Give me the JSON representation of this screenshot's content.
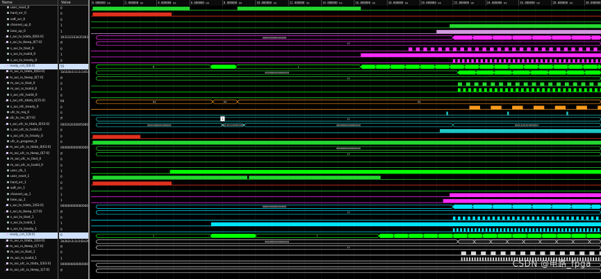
{
  "headers": {
    "name": "Name",
    "value": "Value"
  },
  "rows": [
    {
      "name": "user_reset_0",
      "value": "0",
      "type": "bit"
    },
    {
      "name": "hard_err_0",
      "value": "0",
      "type": "bit"
    },
    {
      "name": "soft_err_0",
      "value": "0",
      "type": "bit"
    },
    {
      "name": "channel_up_0",
      "value": "1",
      "type": "bit"
    },
    {
      "name": "lane_up_0",
      "value": "1",
      "type": "bit"
    },
    {
      "name": "s_axi_tx_tdata_0[63:0]",
      "value": "303132333435363?",
      "type": "bus"
    },
    {
      "name": "s_axi_tx_tkeep_0[7:0]",
      "value": "ff",
      "type": "bus"
    },
    {
      "name": "s_axi_tx_tlast_0",
      "value": "0",
      "type": "bit"
    },
    {
      "name": "s_axi_tx_tvalid_0",
      "value": "1",
      "type": "bit"
    },
    {
      "name": "s_axi_tx_tready_0",
      "value": "0",
      "type": "bit"
    },
    {
      "name": "ready_cnt_0[8:0]",
      "value": "55",
      "type": "bus",
      "selected": true
    },
    {
      "name": "m_axi_rx_tdata_0[63:0]",
      "value": "1b1b1b1c1c1c1d1e",
      "type": "bus"
    },
    {
      "name": "m_axi_rx_tkeep_0[7:0]",
      "value": "ff",
      "type": "bus"
    },
    {
      "name": "m_axi_rx_tlast_0",
      "value": "0",
      "type": "bit"
    },
    {
      "name": "m_axi_rx_tvalid_0",
      "value": "1",
      "type": "bit"
    },
    {
      "name": "s_axi_nfc_tvalid_0",
      "value": "0",
      "type": "bit"
    },
    {
      "name": "s_axi_nfc_tdata_0[15:0]",
      "value": "64",
      "type": "bus"
    },
    {
      "name": "s_axi_nfc_tready_0",
      "value": "0",
      "type": "bit"
    },
    {
      "name": "ufc_tx_req_0",
      "value": "0",
      "type": "bit"
    },
    {
      "name": "ufc_tx_ms_0[7:0]",
      "value": "ff",
      "type": "bus"
    },
    {
      "name": "s_axi_ufc_tx_tdata_0[63:0]",
      "value": "000102030405060?",
      "type": "bus"
    },
    {
      "name": "s_axi_ufc_tx_tvalid_0",
      "value": "0",
      "type": "bit"
    },
    {
      "name": "s_axi_ufc_tx_tready_0",
      "value": "0",
      "type": "bit"
    },
    {
      "name": "ufc_in_progress_0",
      "value": "0",
      "type": "bit"
    },
    {
      "name": "m_axi_ufc_rx_tdata_0[63:0]",
      "value": "000000000000000?",
      "type": "bus"
    },
    {
      "name": "m_axi_ufc_rx_tkeep_0[7:0]",
      "value": "ff",
      "type": "bus"
    },
    {
      "name": "m_axi_ufc_rx_tlast_0",
      "value": "0",
      "type": "bit"
    },
    {
      "name": "m_axi_ufc_rx_tvalid_0",
      "value": "0",
      "type": "bit"
    },
    {
      "name": "user_clk_1",
      "value": "1",
      "type": "bit"
    },
    {
      "name": "user_reset_1",
      "value": "0",
      "type": "bit"
    },
    {
      "name": "hard_err_1",
      "value": "0",
      "type": "bit"
    },
    {
      "name": "soft_err_1",
      "value": "0",
      "type": "bit"
    },
    {
      "name": "channel_up_1",
      "value": "1",
      "type": "bit"
    },
    {
      "name": "lane_up_1",
      "value": "1",
      "type": "bit"
    },
    {
      "name": "s_axi_tx_tdata_1[63:0]",
      "value": "000000000000000?",
      "type": "bus"
    },
    {
      "name": "s_axi_tx_tkeep_1[7:0]",
      "value": "ff",
      "type": "bus"
    },
    {
      "name": "s_axi_tx_tlast_1",
      "value": "0",
      "type": "bit"
    },
    {
      "name": "s_axi_tx_tvalid_1",
      "value": "1",
      "type": "bit"
    },
    {
      "name": "s_axi_tx_tready_1",
      "value": "0",
      "type": "bit"
    },
    {
      "name": "ready_cnt_1[8:0]",
      "value": "0",
      "type": "bus",
      "selected": true
    },
    {
      "name": "m_axi_rx_tdata_1[63:0]",
      "value": "2b2b2c2c2c2d2e2f",
      "type": "bus"
    },
    {
      "name": "m_axi_rx_tkeep_1[7:0]",
      "value": "ff",
      "type": "bus"
    },
    {
      "name": "m_axi_rx_tlast_1",
      "value": "0",
      "type": "bit"
    },
    {
      "name": "m_axi_rx_tvalid_1",
      "value": "1",
      "type": "bit"
    },
    {
      "name": "m_axi_ufc_rx_tdata_1[63:0]",
      "value": "000000000000000?",
      "type": "bus"
    },
    {
      "name": "m_axi_ufc_rx_tkeep_1[7:0]",
      "value": "ff",
      "type": "bus"
    }
  ],
  "timeline": {
    "ticks": [
      "0.000000 us",
      "2.000000 us",
      "4.000000 us",
      "6.000000 us",
      "8.000000 us",
      "10.000000 us",
      "12.000000 us",
      "14.000000 us",
      "16.000000 us",
      "18.000000 us",
      "20.000000 us",
      "22.000000 us",
      "24.000000 us",
      "26.000000 us",
      "28.000000 us",
      "30.000000 us"
    ],
    "range_us": [
      0,
      31
    ]
  },
  "bus_labels": {
    "tdata0": "0000000000000000",
    "ff": "ff",
    "zero": "0",
    "one": "1",
    "rx0": "0000000000000000",
    "nfc": "64",
    "nfc_short": "64",
    "ufc_tx_a": "0000000000000000",
    "ufc_tx_b": "0001020304050607",
    "ufc_tx_c": "0001020304050607",
    "ufc_rx": "0000000000000000",
    "marker": "1",
    "tx1": "0000000000000000",
    "rx1": "0000000000000000"
  },
  "colors": {
    "bit": "#23d72f",
    "bit_bright": "#00ff00",
    "bus_line": "#27c227",
    "tx_magenta": "#ff2cff",
    "cyan": "#00e5ff",
    "orange": "#ff9a1a",
    "red": "#e0301e",
    "pink": "#d69ae0",
    "teal": "#1fc6c6",
    "yellow": "#e6e626",
    "selection": "#cfe1fb"
  },
  "watermark": "CSDN @电路_fpga"
}
